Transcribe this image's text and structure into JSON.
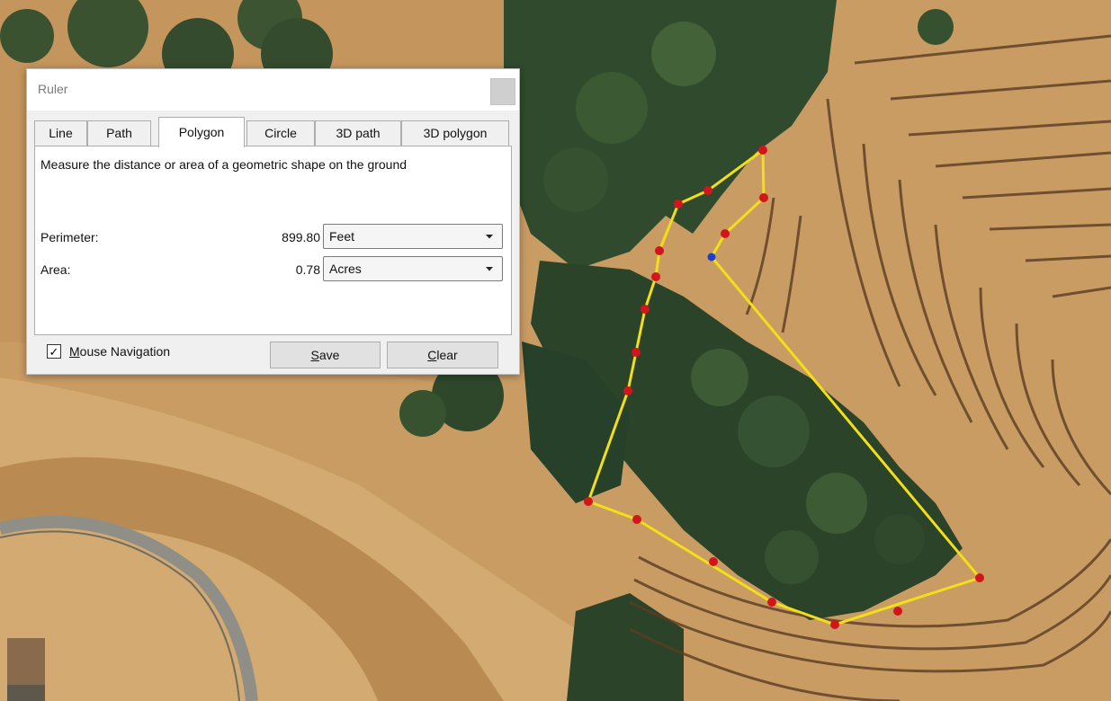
{
  "dialog": {
    "title": "Ruler",
    "tabs": [
      {
        "label": "Line"
      },
      {
        "label": "Path"
      },
      {
        "label": "Polygon"
      },
      {
        "label": "Circle"
      },
      {
        "label": "3D path"
      },
      {
        "label": "3D polygon"
      }
    ],
    "active_tab": "Polygon",
    "description": "Measure the distance or area of a geometric shape on the ground",
    "perimeter": {
      "label": "Perimeter:",
      "value": "899.80",
      "unit": "Feet"
    },
    "area": {
      "label": "Area:",
      "value": "0.78",
      "unit": "Acres"
    },
    "mouse_navigation": {
      "label_first": "M",
      "label_rest": "ouse Navigation",
      "checked": true,
      "check_glyph": "✓"
    },
    "save": {
      "label_first": "S",
      "label_rest": "ave"
    },
    "clear": {
      "label_first": "C",
      "label_rest": "lear"
    }
  },
  "map": {
    "polygon_color": "#f2df1a",
    "vertex_color": "#d2151b",
    "active_vertex_color": "#1a3fd0"
  }
}
